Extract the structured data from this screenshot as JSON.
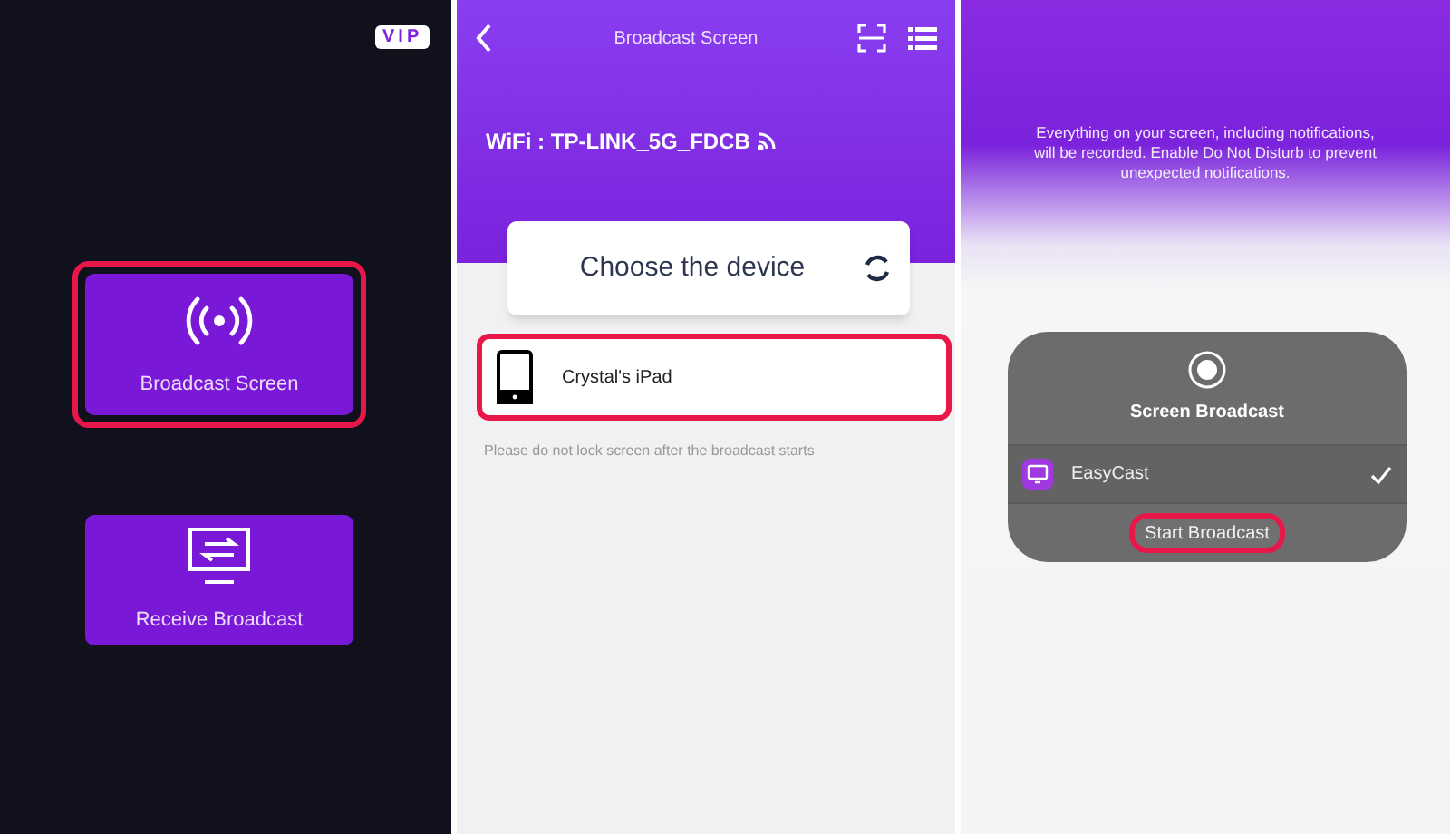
{
  "home": {
    "badge": "VIP",
    "actions": [
      {
        "kind": "broadcast",
        "label": "Broadcast Screen",
        "highlighted": true
      },
      {
        "kind": "receive",
        "label": "Receive Broadcast",
        "highlighted": false
      }
    ]
  },
  "device_screen": {
    "title": "Broadcast Screen",
    "wifi": "WiFi : TP-LINK_5G_FDCB",
    "card_title": "Choose the device",
    "devices": [
      {
        "name": "Crystal's iPad",
        "highlighted": true
      }
    ],
    "note": "Please do not lock screen after the broadcast starts"
  },
  "broadcast_sheet": {
    "notice": "Everything on your screen, including notifications, will be recorded. Enable Do Not Disturb to prevent unexpected notifications.",
    "title": "Screen Broadcast",
    "apps": [
      {
        "name": "EasyCast",
        "checked": true
      }
    ],
    "start_button": {
      "label": "Start Broadcast",
      "highlighted": true
    }
  }
}
